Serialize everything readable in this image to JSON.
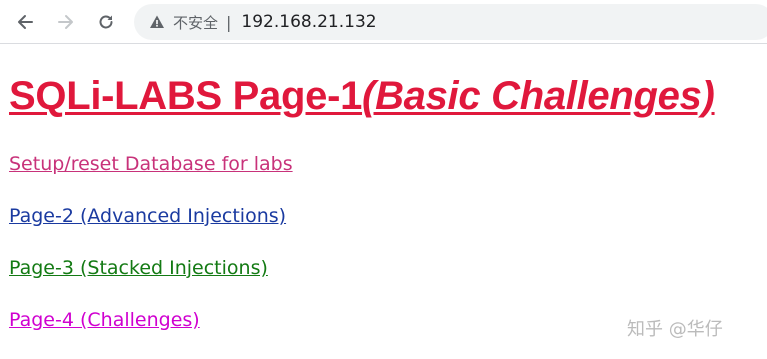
{
  "browser": {
    "back_icon": "arrow-left-icon",
    "forward_icon": "arrow-right-icon",
    "reload_icon": "reload-icon",
    "security_icon": "warning-triangle-icon",
    "security_label": "不安全",
    "separator": "|",
    "url": "192.168.21.132"
  },
  "page": {
    "title_main": "SQLi-LABS Page-1",
    "title_sub": "(Basic Challenges)",
    "links": {
      "setup": "Setup/reset Database for labs",
      "page2": "Page-2 (Advanced Injections)",
      "page3": "Page-3 (Stacked Injections)",
      "page4": "Page-4 (Challenges)"
    }
  },
  "watermark": "知乎 @华仔",
  "colors": {
    "title": "#e0183c",
    "setup": "#c8327a",
    "page2": "#1a3aa0",
    "page3": "#137a13",
    "page4": "#d000d0"
  }
}
